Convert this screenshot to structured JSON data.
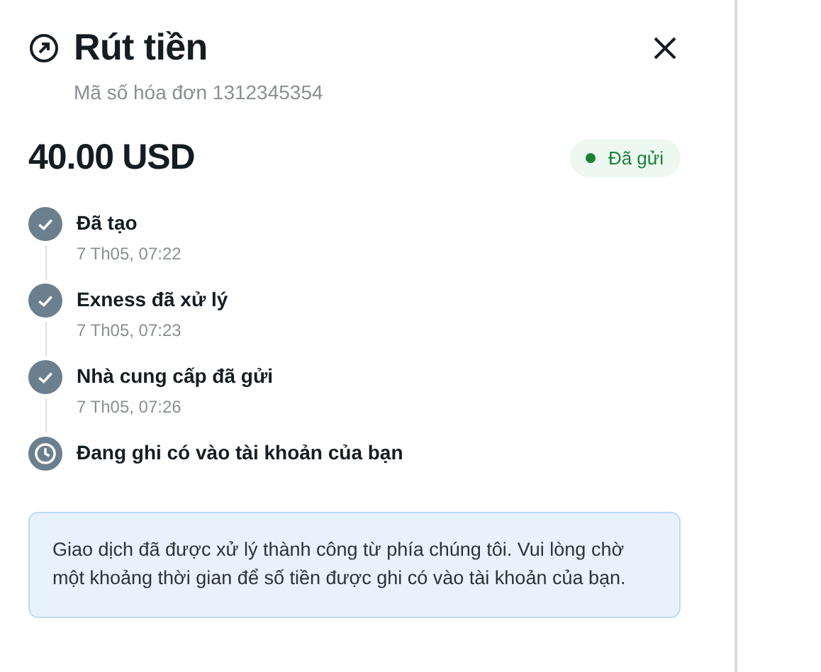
{
  "header": {
    "title": "Rút tiền",
    "subtitle": "Mã số hóa đơn 1312345354"
  },
  "amount": {
    "value": "40.00",
    "currency": "USD",
    "status": {
      "label": "Đã gửi",
      "color": "#1a7f37"
    }
  },
  "steps": [
    {
      "kind": "done",
      "label": "Đã tạo",
      "time": "7 Th05, 07:22"
    },
    {
      "kind": "done",
      "label": "Exness đã xử lý",
      "time": "7 Th05, 07:23"
    },
    {
      "kind": "done",
      "label": "Nhà cung cấp đã gửi",
      "time": "7 Th05, 07:26"
    },
    {
      "kind": "pending",
      "label": "Đang ghi có vào tài khoản của bạn"
    }
  ],
  "notice": "Giao dịch đã được xử lý thành công từ phía chúng tôi. Vui lòng chờ một khoảng thời gian để số tiền được ghi có vào tài khoản của bạn."
}
